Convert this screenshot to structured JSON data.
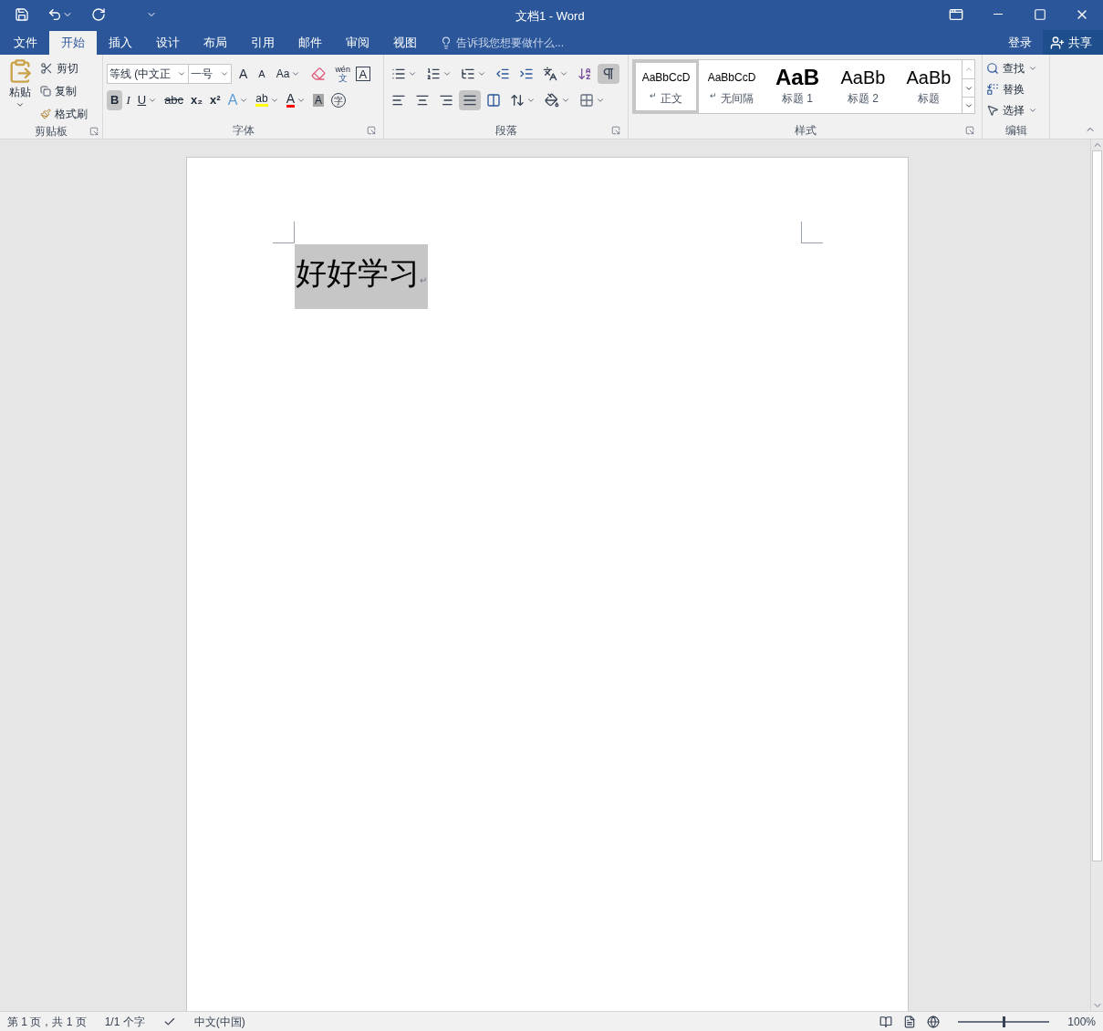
{
  "window": {
    "title": "文档1 - Word"
  },
  "tabs": [
    {
      "label": "文件",
      "selected": false
    },
    {
      "label": "开始",
      "selected": true
    },
    {
      "label": "插入",
      "selected": false
    },
    {
      "label": "设计",
      "selected": false
    },
    {
      "label": "布局",
      "selected": false
    },
    {
      "label": "引用",
      "selected": false
    },
    {
      "label": "邮件",
      "selected": false
    },
    {
      "label": "审阅",
      "selected": false
    },
    {
      "label": "视图",
      "selected": false
    }
  ],
  "tell_me": {
    "placeholder": "告诉我您想要做什么..."
  },
  "account": {
    "sign_in": "登录",
    "share": "共享"
  },
  "clipboard": {
    "label": "剪贴板",
    "paste": "粘贴",
    "cut": "剪切",
    "copy": "复制",
    "format_painter": "格式刷"
  },
  "font": {
    "label": "字体",
    "font_name": "等线 (中文正",
    "font_size": "一号",
    "grow": "A",
    "shrink": "A",
    "change_case": "Aa",
    "phonetic_top": "wén",
    "phonetic_bottom": "文",
    "border_char": "A",
    "format_buttons": [
      {
        "label": "B",
        "kind": "bold",
        "selected": true
      },
      {
        "label": "I",
        "kind": "italic",
        "selected": false
      },
      {
        "label": "U",
        "kind": "underline",
        "selected": false
      },
      {
        "label": "abc",
        "kind": "strike",
        "selected": false
      },
      {
        "label": "x₂",
        "kind": "plain",
        "selected": false
      },
      {
        "label": "x²",
        "kind": "plain",
        "selected": false
      }
    ],
    "effects": "A",
    "highlight": "ab",
    "font_color": "A",
    "shading": "A",
    "enclose": "字"
  },
  "paragraph": {
    "label": "段落",
    "show_marks": true,
    "align": [
      {
        "kind": "left",
        "selected": false
      },
      {
        "kind": "center",
        "selected": false
      },
      {
        "kind": "right",
        "selected": false
      },
      {
        "kind": "justify",
        "selected": true
      },
      {
        "kind": "distributed",
        "selected": false
      }
    ]
  },
  "styles": {
    "label": "样式",
    "items": [
      {
        "preview": "AaBbCcD",
        "mark": "↵",
        "name": "正文",
        "kind": "normal",
        "selected": true
      },
      {
        "preview": "AaBbCcD",
        "mark": "↵",
        "name": "无间隔",
        "kind": "normal",
        "selected": false
      },
      {
        "preview": "AaB",
        "name": "标题 1",
        "kind": "heading1",
        "selected": false
      },
      {
        "preview": "AaBb",
        "name": "标题 2",
        "kind": "heading2",
        "selected": false
      },
      {
        "preview": "AaBb",
        "name": "标题",
        "kind": "title",
        "selected": false
      }
    ]
  },
  "editing": {
    "label": "编辑",
    "find": "查找",
    "replace": "替换",
    "select": "选择"
  },
  "document": {
    "paragraphs": [
      {
        "text": "好好学习",
        "selected": true,
        "mark": "↵"
      }
    ]
  },
  "status_bar": {
    "page": "第 1 页，共 1 页",
    "words": "1/1 个字",
    "language": "中文(中国)",
    "zoom": "100%",
    "zoom_slider": {
      "level": 0.5
    }
  }
}
